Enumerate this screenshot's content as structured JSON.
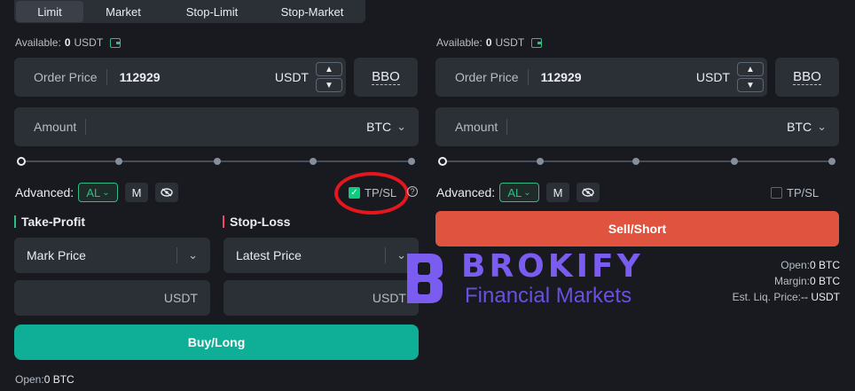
{
  "tabs": [
    "Limit",
    "Market",
    "Stop-Limit",
    "Stop-Market"
  ],
  "buy": {
    "available_label": "Available:",
    "available_value": "0",
    "available_unit": "USDT",
    "order_price_label": "Order Price",
    "order_price_value": "112929",
    "order_price_unit": "USDT",
    "bbo_label": "BBO",
    "amount_label": "Amount",
    "amount_unit": "BTC",
    "advanced_label": "Advanced:",
    "al_label": "AL",
    "m_label": "M",
    "tpsl_label": "TP/SL",
    "tpsl_checked": true,
    "take_profit_label": "Take-Profit",
    "stop_loss_label": "Stop-Loss",
    "tp_trigger": "Mark Price",
    "sl_trigger": "Latest Price",
    "tp_unit": "USDT",
    "sl_unit": "USDT",
    "button_label": "Buy/Long",
    "open_label": "Open:",
    "open_value": "0 BTC"
  },
  "sell": {
    "available_label": "Available:",
    "available_value": "0",
    "available_unit": "USDT",
    "order_price_label": "Order Price",
    "order_price_value": "112929",
    "order_price_unit": "USDT",
    "bbo_label": "BBO",
    "amount_label": "Amount",
    "amount_unit": "BTC",
    "advanced_label": "Advanced:",
    "al_label": "AL",
    "m_label": "M",
    "tpsl_label": "TP/SL",
    "tpsl_checked": false,
    "button_label": "Sell/Short",
    "open_label": "Open:",
    "open_value": "0 BTC",
    "margin_label": "Margin:",
    "margin_value": "0 BTC",
    "liq_label": "Est. Liq. Price:",
    "liq_value": "-- USDT"
  },
  "watermark": {
    "brand": "BROKIFY",
    "tagline": "Financial Markets"
  },
  "colors": {
    "background": "#181a20",
    "buy_button": "#0fae96",
    "sell_button": "#e0533f",
    "accent_green": "#2ebd85",
    "highlight_ring": "#e5161e",
    "watermark": "#7b5cf0"
  }
}
